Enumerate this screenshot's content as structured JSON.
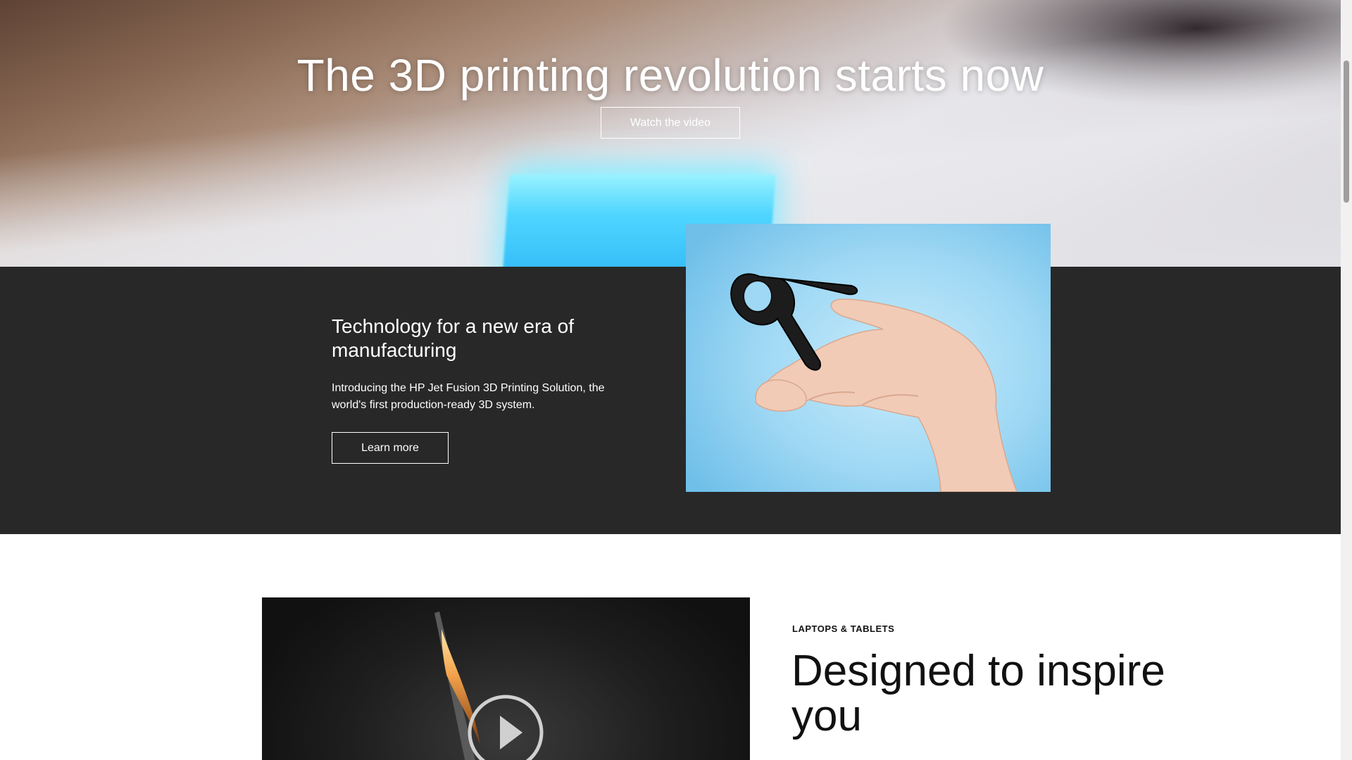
{
  "hero": {
    "title": "The 3D printing revolution starts now",
    "cta_label": "Watch the video"
  },
  "feature": {
    "title": "Technology for a new era of manufacturing",
    "description": "Introducing the HP Jet Fusion 3D Printing Solution, the world's first production-ready 3D system.",
    "cta_label": "Learn more",
    "image_icon": "hand-holding-3d-printed-part"
  },
  "promo": {
    "eyebrow": "LAPTOPS & TABLETS",
    "title": "Designed to inspire you",
    "video_icon": "play-icon"
  },
  "colors": {
    "dark_section": "#282828",
    "cube_glow": "#4fd6ff",
    "image_bg": "#9fd8f4"
  }
}
